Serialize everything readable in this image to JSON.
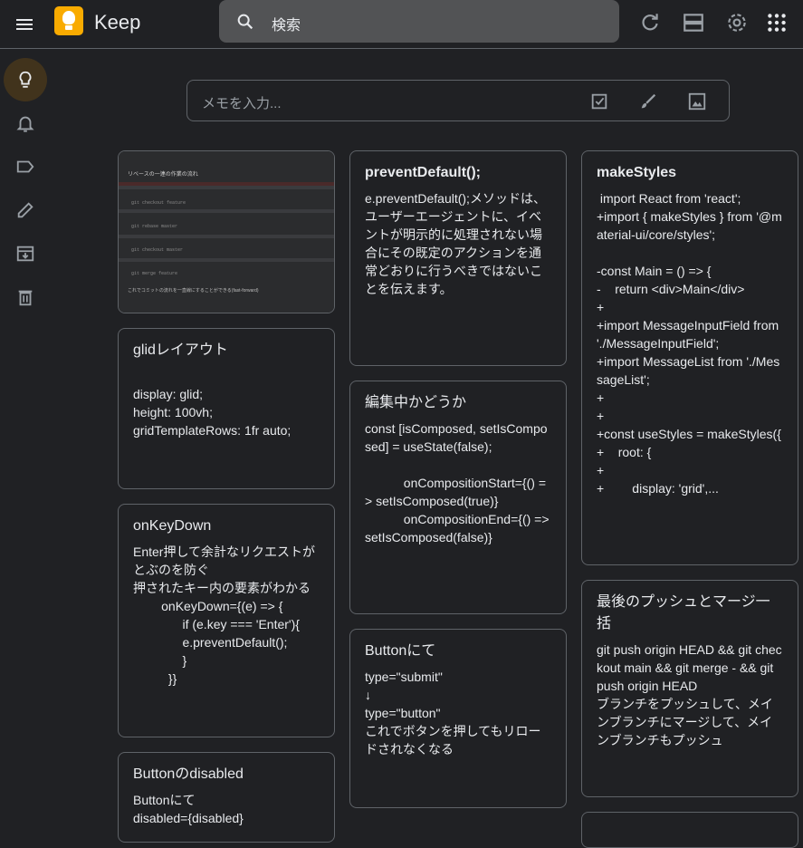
{
  "header": {
    "app_title": "Keep",
    "search_placeholder": "検索"
  },
  "icons": {
    "menu": "menu-icon",
    "logo": "keep-logo-icon",
    "search": "search-icon",
    "refresh": "refresh-icon",
    "list_view": "list-view-icon",
    "settings": "gear-icon",
    "apps": "apps-grid-icon"
  },
  "sidebar": {
    "items": [
      {
        "name": "notes",
        "icon": "lightbulb-icon",
        "active": true
      },
      {
        "name": "reminders",
        "icon": "bell-icon",
        "active": false
      },
      {
        "name": "labels",
        "icon": "label-icon",
        "active": false
      },
      {
        "name": "edit-labels",
        "icon": "pencil-icon",
        "active": false
      },
      {
        "name": "archive",
        "icon": "archive-icon",
        "active": false
      },
      {
        "name": "trash",
        "icon": "trash-icon",
        "active": false
      }
    ]
  },
  "composer": {
    "placeholder": "メモを入力..."
  },
  "notes": {
    "image_note": {
      "title": "リベースの一連の作業の流れ",
      "commands": [
        "git checkout feature",
        "git rebase master",
        "git checkout master",
        "git merge feature"
      ],
      "footer": "これでコミットの流れを一直線にすることができる(fast-forward)"
    },
    "glid": {
      "title": "glidレイアウト",
      "body": "\ndisplay: glid;\nheight: 100vh;\ngridTemplateRows: 1fr auto;"
    },
    "onkeydown": {
      "title": "onKeyDown",
      "body": "Enter押して余計なリクエストがとぶのを防ぐ\n押されたキー内の要素がわかる\n        onKeyDown={(e) => {\n              if (e.key === 'Enter'){\n              e.preventDefault();\n              }\n          }}"
    },
    "button_disabled": {
      "title": "Buttonのdisabled",
      "body": "Buttonにて\ndisabled={disabled}"
    },
    "preventdefault": {
      "title": "preventDefault();",
      "body": "e.preventDefault();メソッドは、ユーザーエージェントに、イベントが明示的に処理されない場合にその既定のアクションを通常どおりに行うべきではないことを伝えます。"
    },
    "composing": {
      "title": "編集中かどうか",
      "body": "const [isComposed, setIsComposed] = useState(false);\n\n           onCompositionStart={() => setIsComposed(true)}\n           onCompositionEnd={() => setIsComposed(false)}"
    },
    "button_type": {
      "title": "Buttonにて",
      "body": "type=\"submit\"\n↓\ntype=\"button\"\nこれでボタンを押してもリロードされなくなる"
    },
    "makestyles": {
      "title": "makeStyles",
      "body": " import React from 'react';\n+import { makeStyles } from '@material-ui/core/styles';\n\n-const Main = () => {\n-    return <div>Main</div>\n+\n+import MessageInputField from './MessageInputField';\n+import MessageList from './MessageList';\n+\n+\n+const useStyles = makeStyles({\n+    root: {\n+\n+        display: 'grid',..."
    },
    "push_merge": {
      "title": "最後のプッシュとマージ一括",
      "body": "git push origin HEAD && git checkout main && git merge - && git push origin HEAD\nブランチをプッシュして、メインブランチにマージして、メインブランチもプッシュ"
    }
  },
  "colors": {
    "background": "#202124",
    "border": "#5f6368",
    "logo_yellow": "#f9ab00",
    "active_sidebar": "#41331c",
    "search_bg": "#525355"
  }
}
